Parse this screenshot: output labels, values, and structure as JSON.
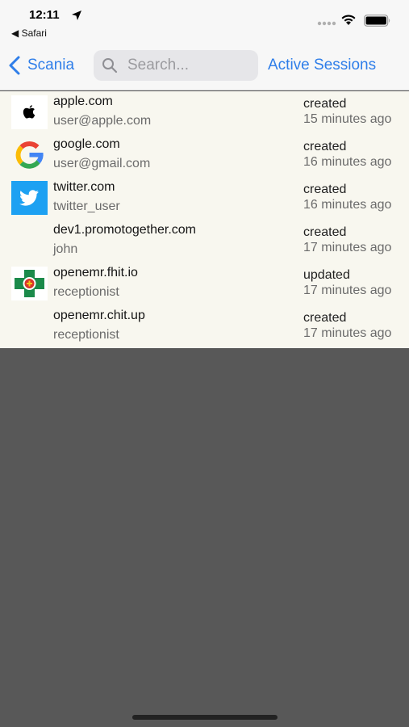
{
  "status_bar": {
    "time": "12:11",
    "back_app": "◀ Safari"
  },
  "nav": {
    "back_label": "Scania",
    "search_placeholder": "Search...",
    "title": "Active Sessions"
  },
  "sessions": [
    {
      "icon": "apple-logo-icon",
      "domain": "apple.com",
      "user": "user@apple.com",
      "status": "created",
      "time": "15 minutes ago"
    },
    {
      "icon": "google-logo-icon",
      "domain": "google.com",
      "user": "user@gmail.com",
      "status": "created",
      "time": "16 minutes ago"
    },
    {
      "icon": "twitter-logo-icon",
      "domain": "twitter.com",
      "user": "twitter_user",
      "status": "created",
      "time": "16 minutes ago"
    },
    {
      "icon": "",
      "domain": "dev1.promotogether.com",
      "user": "john",
      "status": "created",
      "time": "17 minutes ago"
    },
    {
      "icon": "openemr-logo-icon",
      "domain": "openemr.fhit.io",
      "user": "receptionist",
      "status": "updated",
      "time": "17 minutes ago"
    },
    {
      "icon": "",
      "domain": "openemr.chit.up",
      "user": "receptionist",
      "status": "created",
      "time": "17 minutes ago"
    }
  ],
  "colors": {
    "accent": "#2f7ee9",
    "list_background": "#f8f7ef",
    "empty_background": "#585858"
  }
}
